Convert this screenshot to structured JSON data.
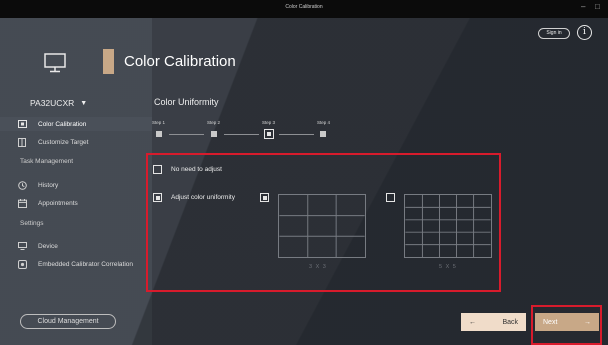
{
  "window": {
    "title": "Color Calibration",
    "minimize_glyph": "–",
    "maximize_glyph": "□"
  },
  "header": {
    "sign_in_label": "Sign in",
    "info_glyph": "i"
  },
  "device": {
    "name": "PA32UCXR",
    "caret": "▼"
  },
  "sidebar": {
    "items": [
      {
        "label": "Color Calibration",
        "icon": "calibration-icon",
        "active": true
      },
      {
        "label": "Customize Target",
        "icon": "target-icon"
      },
      {
        "section": "Task Management"
      },
      {
        "label": "History",
        "icon": "history-icon"
      },
      {
        "label": "Appointments",
        "icon": "calendar-icon"
      },
      {
        "section": "Settings"
      },
      {
        "label": "Device",
        "icon": "monitor-icon"
      },
      {
        "label": "Embedded Calibrator Correlation",
        "icon": "calibrator-icon"
      }
    ],
    "cloud_button": "Cloud Management"
  },
  "page": {
    "title": "Color Calibration",
    "section_title": "Color Uniformity"
  },
  "stepper": {
    "steps": [
      "Step 1",
      "Step 2",
      "Step 3",
      "Step 4"
    ],
    "current_step": 3
  },
  "options": {
    "no_adjust": {
      "label": "No need to adjust",
      "checked": false
    },
    "adjust": {
      "label": "Adjust color uniformity",
      "checked": true
    },
    "grid_3x3": {
      "caption": "3 X 3",
      "checked": true
    },
    "grid_5x5": {
      "caption": "5 X 5",
      "checked": false
    }
  },
  "footer": {
    "back_label": "Back",
    "back_arrow": "←",
    "next_label": "Next",
    "next_arrow": "→"
  },
  "colors": {
    "accent": "#c8a887",
    "highlight": "#d81b2c",
    "back_bg": "#f0dcc9"
  }
}
